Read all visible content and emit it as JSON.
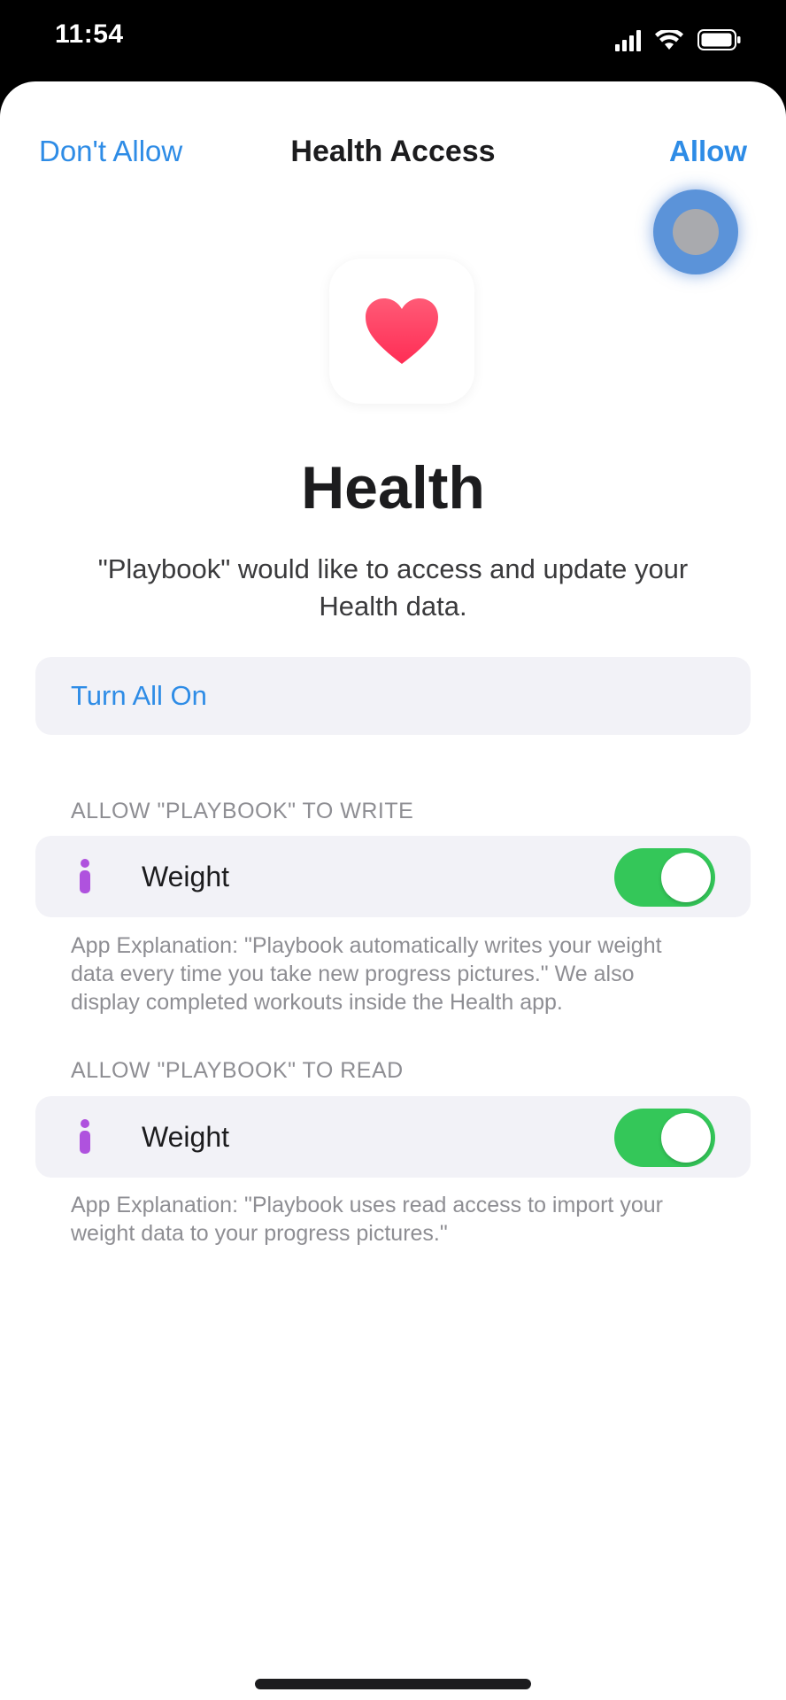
{
  "status_bar": {
    "time": "11:54"
  },
  "nav": {
    "cancel_label": "Don't Allow",
    "title": "Health Access",
    "confirm_label": "Allow"
  },
  "app": {
    "icon": "heart-icon",
    "title": "Health",
    "subtitle": "\"Playbook\" would like to access and update your Health data."
  },
  "turn_all": {
    "label": "Turn All On"
  },
  "sections": [
    {
      "header": "ALLOW \"PLAYBOOK\" TO WRITE",
      "item": {
        "icon": "body-measurement-icon",
        "label": "Weight",
        "enabled": true
      },
      "explanation": "App Explanation: \"Playbook automatically writes your weight data every time you take new progress pictures.\" We also display completed workouts inside the Health app."
    },
    {
      "header": "ALLOW \"PLAYBOOK\" TO READ",
      "item": {
        "icon": "body-measurement-icon",
        "label": "Weight",
        "enabled": true
      },
      "explanation": "App Explanation: \"Playbook uses read access to import your weight data to your progress pictures.\""
    }
  ],
  "colors": {
    "accent": "#2e8ce6",
    "toggle_on": "#34c759",
    "heart": "#ff2d55",
    "body_icon": "#af52de"
  }
}
